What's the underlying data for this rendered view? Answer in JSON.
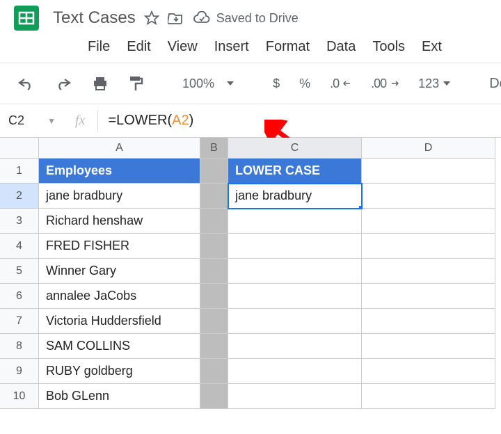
{
  "header": {
    "document_title": "Text Cases",
    "saved_status": "Saved to Drive"
  },
  "menubar": {
    "items": [
      "File",
      "Edit",
      "View",
      "Insert",
      "Format",
      "Data",
      "Tools",
      "Ext"
    ]
  },
  "toolbar": {
    "zoom": "100%",
    "currency": "$",
    "percent": "%",
    "dec_dec": ".0",
    "dec_inc": ".00",
    "num_fmt": "123",
    "font": "Def"
  },
  "name_box": {
    "value": "C2"
  },
  "formula": {
    "prefix": "=LOWER(",
    "ref": "A2",
    "suffix": ")"
  },
  "columns": [
    "A",
    "B",
    "C",
    "D"
  ],
  "rows": [
    {
      "n": "1",
      "A": "Employees",
      "B": "",
      "C": "LOWER CASE"
    },
    {
      "n": "2",
      "A": "jane bradbury",
      "B": "",
      "C": "jane bradbury"
    },
    {
      "n": "3",
      "A": "Richard henshaw",
      "B": "",
      "C": ""
    },
    {
      "n": "4",
      "A": "FRED FISHER",
      "B": "",
      "C": ""
    },
    {
      "n": "5",
      "A": "Winner Gary",
      "B": "",
      "C": ""
    },
    {
      "n": "6",
      "A": "annalee JaCobs",
      "B": "",
      "C": ""
    },
    {
      "n": "7",
      "A": "Victoria Huddersfield",
      "B": "",
      "C": ""
    },
    {
      "n": "8",
      "A": "SAM COLLINS",
      "B": "",
      "C": ""
    },
    {
      "n": "9",
      "A": "RUBY goldberg",
      "B": "",
      "C": ""
    },
    {
      "n": "10",
      "A": "Bob GLenn",
      "B": "",
      "C": ""
    }
  ],
  "active_cell": "C2"
}
